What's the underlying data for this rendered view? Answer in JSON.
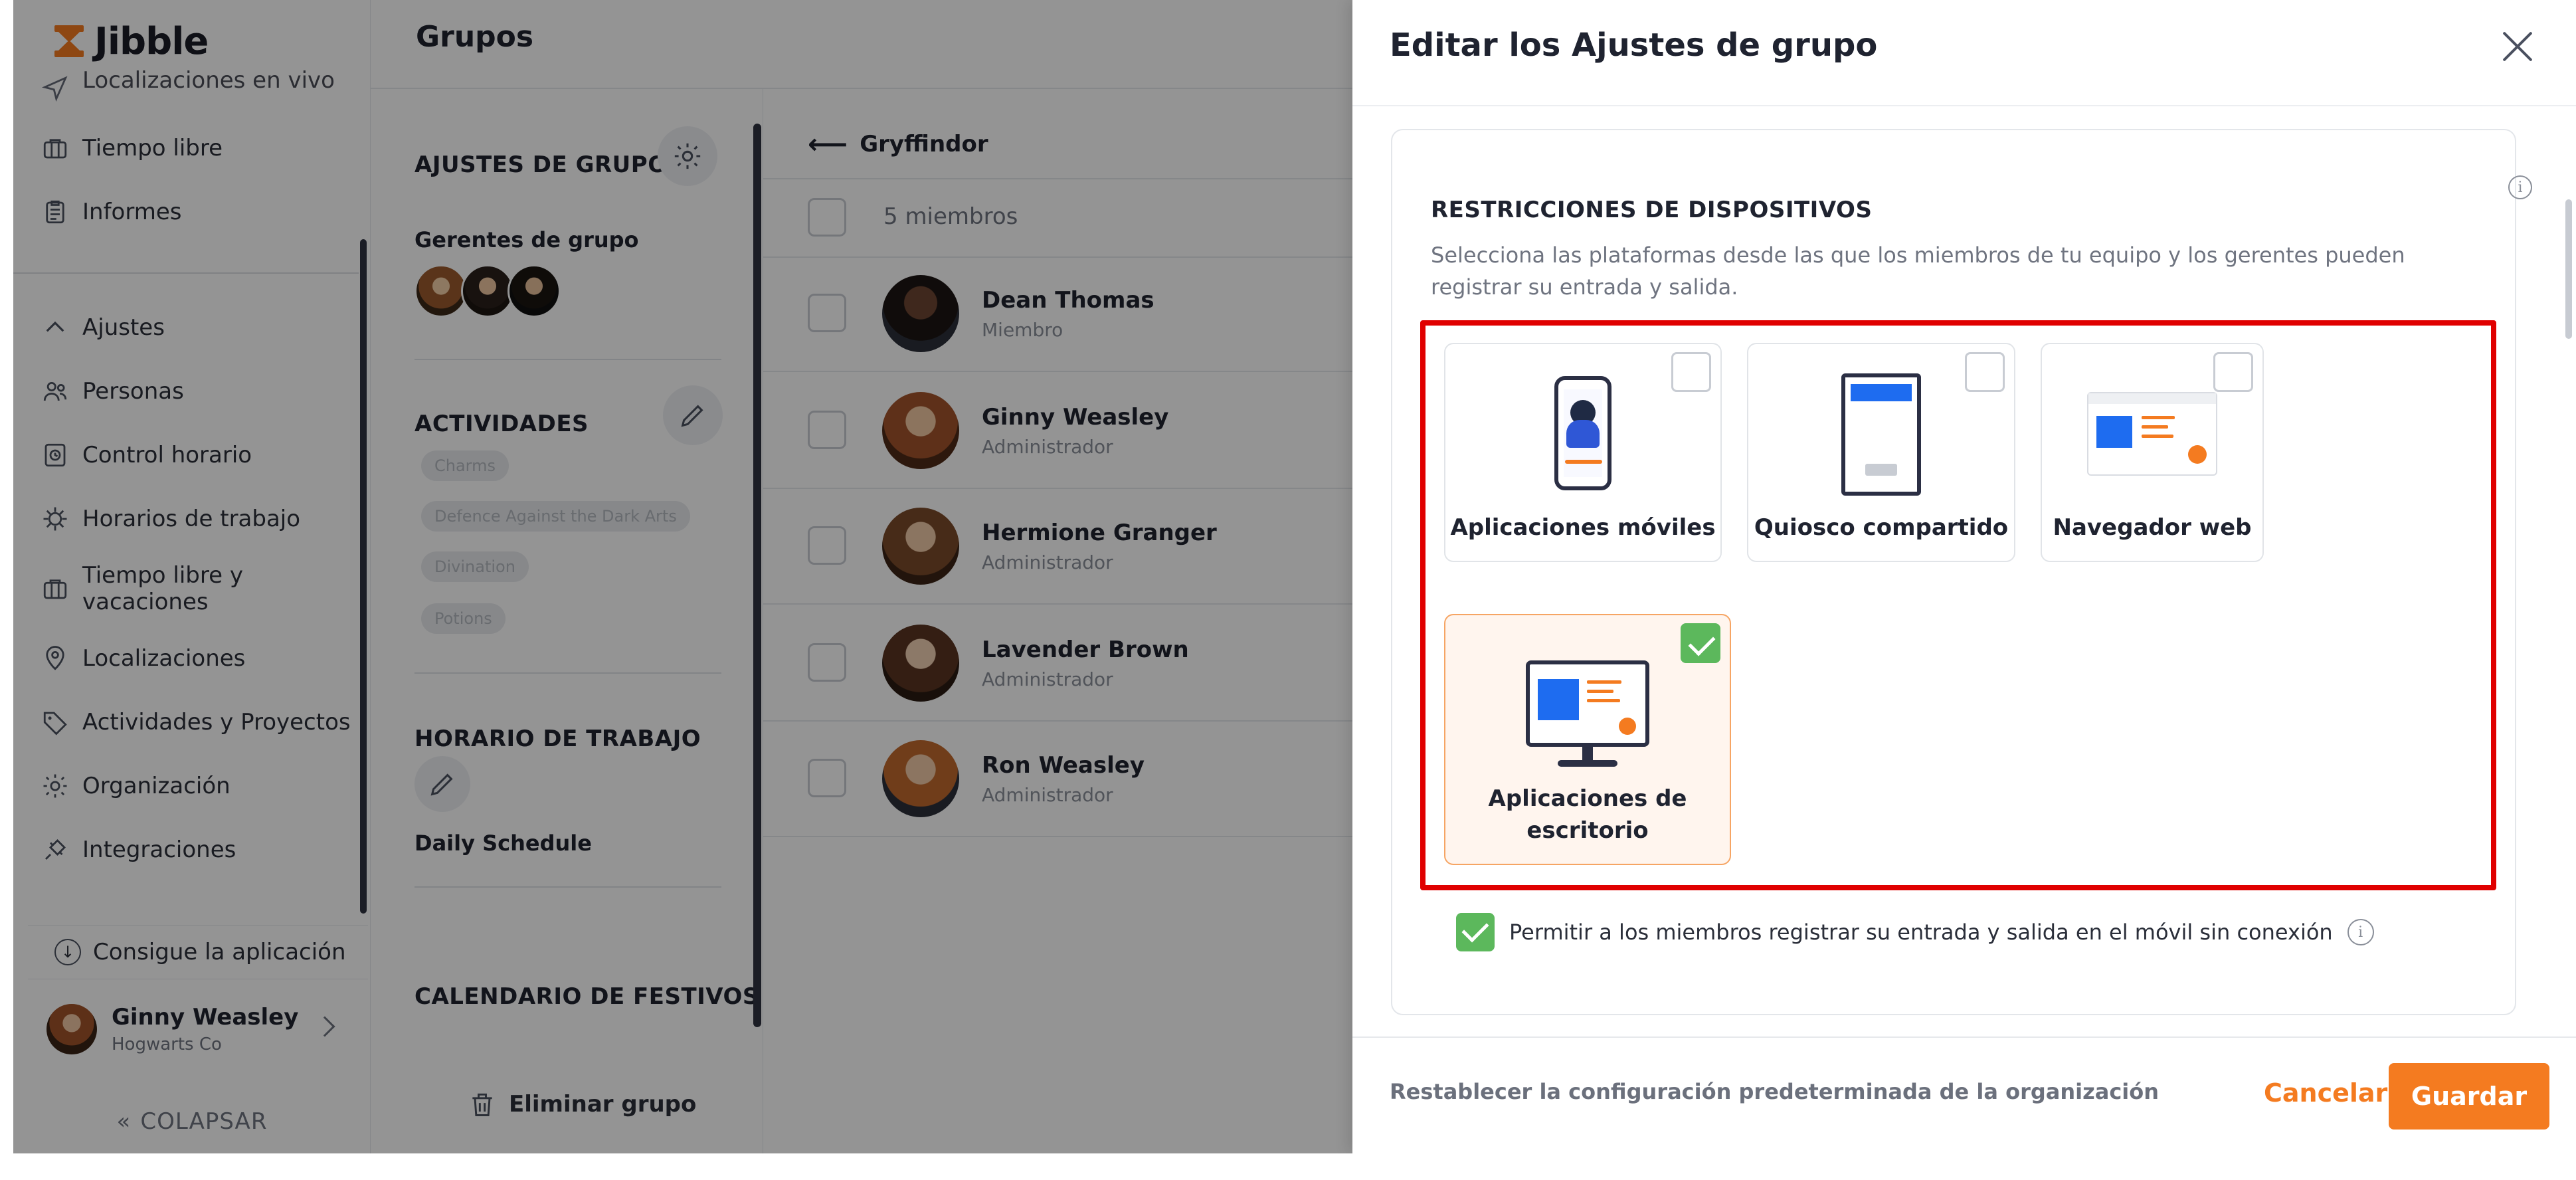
{
  "brand": {
    "name": "Jibble",
    "accent": "#f47b20"
  },
  "page": {
    "title": "Grupos"
  },
  "sidebar": {
    "top_partial": "Localizaciones en vivo",
    "items": [
      {
        "label": "Tiempo libre",
        "icon": "briefcase-icon"
      },
      {
        "label": "Informes",
        "icon": "clipboard-icon"
      },
      {
        "label": "Ajustes",
        "icon": "chevron-up-icon"
      },
      {
        "label": "Personas",
        "icon": "people-icon"
      },
      {
        "label": "Control horario",
        "icon": "time-tracking-icon"
      },
      {
        "label": "Horarios de trabajo",
        "icon": "schedule-icon"
      },
      {
        "label": "Tiempo libre y vacaciones",
        "icon": "briefcase-icon"
      },
      {
        "label": "Localizaciones",
        "icon": "location-pin-icon"
      },
      {
        "label": "Actividades y Proyectos",
        "icon": "tag-icon"
      },
      {
        "label": "Organización",
        "icon": "gear-icon"
      },
      {
        "label": "Integraciones",
        "icon": "plug-icon"
      }
    ],
    "get_app": "Consigue la aplicación",
    "user": {
      "name": "Ginny Weasley",
      "org": "Hogwarts Co"
    },
    "collapse": "COLAPSAR"
  },
  "group": {
    "settings_title": "AJUSTES DE GRUPO",
    "managers_title": "Gerentes de grupo",
    "activities_title": "ACTIVIDADES",
    "activities": [
      "Charms",
      "Defence Against the Dark Arts",
      "Divination",
      "Potions"
    ],
    "work_schedule_title": "HORARIO DE TRABAJO",
    "schedule_name": "Daily Schedule",
    "holidays_title": "CALENDARIO DE FESTIVOS",
    "delete": "Eliminar grupo"
  },
  "members": {
    "group_name": "Gryffindor",
    "count_label": "5 miembros",
    "list": [
      {
        "name": "Dean Thomas",
        "role": "Miembro"
      },
      {
        "name": "Ginny Weasley",
        "role": "Administrador"
      },
      {
        "name": "Hermione Granger",
        "role": "Administrador"
      },
      {
        "name": "Lavender Brown",
        "role": "Administrador"
      },
      {
        "name": "Ron Weasley",
        "role": "Administrador"
      }
    ]
  },
  "drawer": {
    "title": "Editar los Ajustes de grupo",
    "restrictions_title": "RESTRICCIONES DE DISPOSITIVOS",
    "restrictions_desc": "Selecciona las plataformas desde las que los miembros de tu equipo y los gerentes pueden registrar su entrada y salida.",
    "options": [
      {
        "label": "Aplicaciones móviles",
        "checked": false
      },
      {
        "label": "Quiosco compartido",
        "checked": false
      },
      {
        "label": "Navegador web",
        "checked": false
      },
      {
        "label": "Aplicaciones de escritorio",
        "checked": true
      }
    ],
    "offline": "Permitir a los miembros registrar su entrada y salida en el móvil sin conexión",
    "reset": "Restablecer la configuración predeterminada de la organización",
    "cancel": "Cancelar",
    "save": "Guardar"
  }
}
